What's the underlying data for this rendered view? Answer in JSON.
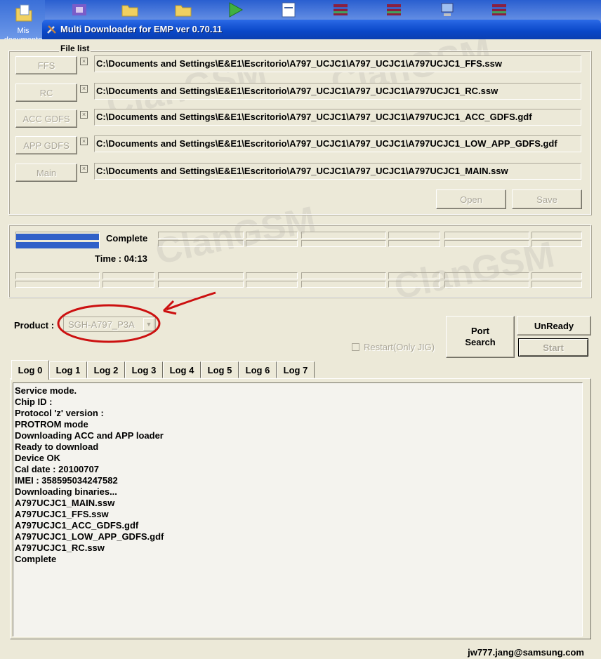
{
  "desktop": {
    "my_documents_label": "Mis documento"
  },
  "window": {
    "title": "Multi Downloader for EMP ver 0.70.11"
  },
  "file_list": {
    "group_label": "File list",
    "rows": [
      {
        "button": "FFS",
        "path": "C:\\Documents and Settings\\E&E1\\Escritorio\\A797_UCJC1\\A797_UCJC1\\A797UCJC1_FFS.ssw"
      },
      {
        "button": "RC",
        "path": "C:\\Documents and Settings\\E&E1\\Escritorio\\A797_UCJC1\\A797_UCJC1\\A797UCJC1_RC.ssw"
      },
      {
        "button": "ACC GDFS",
        "path": "C:\\Documents and Settings\\E&E1\\Escritorio\\A797_UCJC1\\A797_UCJC1\\A797UCJC1_ACC_GDFS.gdf"
      },
      {
        "button": "APP GDFS",
        "path": "C:\\Documents and Settings\\E&E1\\Escritorio\\A797_UCJC1\\A797_UCJC1\\A797UCJC1_LOW_APP_GDFS.gdf"
      },
      {
        "button": "Main",
        "path": "C:\\Documents and Settings\\E&E1\\Escritorio\\A797_UCJC1\\A797_UCJC1\\A797UCJC1_MAIN.ssw"
      }
    ],
    "open_label": "Open",
    "save_label": "Save"
  },
  "progress": {
    "status": "Complete",
    "time": "Time : 04:13",
    "fill_fraction": 1.0
  },
  "product": {
    "label": "Product :",
    "value": "SGH-A797_P3A"
  },
  "controls": {
    "port_search_line1": "Port",
    "port_search_line2": "Search",
    "unready_label": "UnReady",
    "start_label": "Start",
    "restart_label": "Restart(Only JIG)"
  },
  "tabs": [
    "Log 0",
    "Log 1",
    "Log 2",
    "Log 3",
    "Log 4",
    "Log 5",
    "Log 6",
    "Log 7"
  ],
  "log_lines": [
    "Service mode.",
    "Chip ID :",
    "Protocol 'z' version :",
    "PROTROM mode",
    "Downloading ACC and APP loader",
    "Ready to download",
    "Device OK",
    "Cal date : 20100707",
    "IMEI : 358595034247582",
    "Downloading binaries...",
    "A797UCJC1_MAIN.ssw",
    "A797UCJC1_FFS.ssw",
    "A797UCJC1_ACC_GDFS.gdf",
    "A797UCJC1_LOW_APP_GDFS.gdf",
    "A797UCJC1_RC.ssw",
    "Complete"
  ],
  "footer": "jw777.jang@samsung.com",
  "colors": {
    "progress_fill": "#3060c8",
    "annotation": "#cc1010",
    "titlebar": "#0a47c8"
  }
}
